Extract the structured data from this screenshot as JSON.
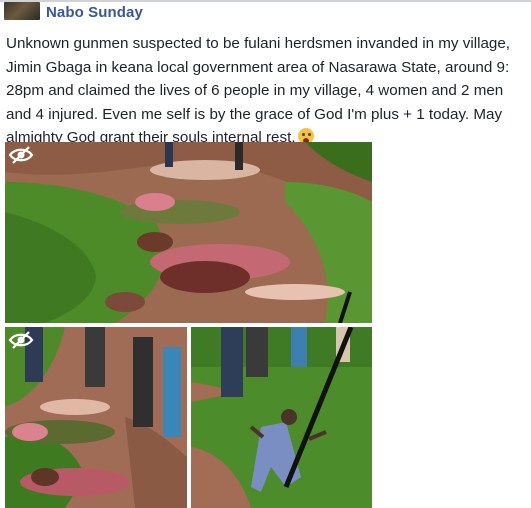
{
  "post": {
    "author": "Nabo Sunday",
    "text": "Unknown gunmen suspected to be fulani herdsmen invanded in my village, Jimin Gbaga in keana local government area of Nasarawa State, around 9: 28pm and claimed the lives of 6 people in my village, 4 women and 2 men and 4 injured. Even me self is by the grace of God I'm plus + 1 today. May almighty God grant their souls internal rest.",
    "emoji": "crying-face-emoji"
  },
  "photos": [
    {
      "id": "photo-main",
      "overlay_icon": "hidden-eye-icon"
    },
    {
      "id": "photo-bottom-left",
      "overlay_icon": "hidden-eye-icon"
    },
    {
      "id": "photo-bottom-right"
    }
  ],
  "colors": {
    "author_link": "#365899",
    "text": "#1d2129",
    "grass": "#4f8a2b",
    "soil": "#a6735a"
  }
}
